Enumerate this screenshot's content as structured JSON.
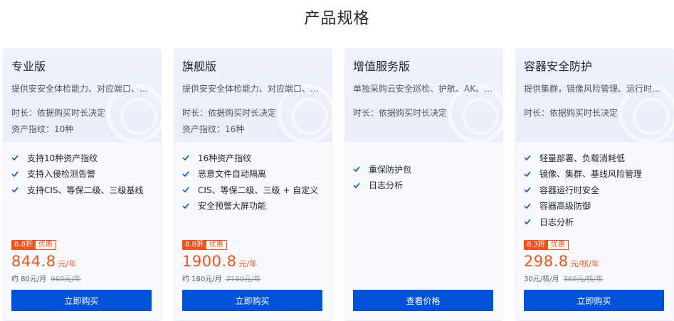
{
  "page_title": "产品规格",
  "icons": {
    "check": "check-icon",
    "watermark": "shield-watermark-icon"
  },
  "colors": {
    "accent": "#0052d9",
    "price": "#f0541e",
    "check": "#0052d9"
  },
  "cards": [
    {
      "title": "专业版",
      "desc": "提供安安全体检能力、对应端口、漏洞风险检测",
      "meta": [
        "时长：依据购买时长决定",
        "资产指纹：10种"
      ],
      "features": [
        "支持10种资产指纹",
        "支持入侵检测告警",
        "支持CIS、等保二级、三级基线"
      ],
      "badge": {
        "discount": "8.8折",
        "label": "优惠"
      },
      "price": "844.8",
      "unit": "元/年",
      "sub": "约 80元/月",
      "orig": "960元/年",
      "button": "立即购买"
    },
    {
      "title": "旗舰版",
      "desc": "提供安安全体检能力、对应端口、漏洞风险检测",
      "meta": [
        "时长：依据购买时长决定",
        "资产指纹：16种"
      ],
      "features": [
        "16种资产指纹",
        "恶意文件自动隔离",
        "CIS、等保二级、三级 + 自定义",
        "安全预警大屏功能"
      ],
      "badge": {
        "discount": "8.8折",
        "label": "优惠"
      },
      "price": "1900.8",
      "unit": "元/年",
      "sub": "约 180元/月",
      "orig": "2160元/年",
      "button": "立即购买"
    },
    {
      "title": "增值服务版",
      "desc": "单独采购云安全巡检、护航、AK、DNS监测服务",
      "meta": [
        "时长：依据购买时长决定"
      ],
      "features": [
        "重保防护包",
        "日志分析"
      ],
      "button": "查看价格"
    },
    {
      "title": "容器安全防护",
      "desc": "提供集群，镜像风险管理、运行时安全防护",
      "meta": [
        "时长：依据购买时长决定"
      ],
      "features": [
        "轻量部署、负载消耗低",
        "镜像、集群、基线风险管理",
        "容器运行时安全",
        "容器高级防御",
        "日志分析"
      ],
      "badge": {
        "discount": "8.3折",
        "label": "优惠"
      },
      "price": "298.8",
      "unit": "元/核/年",
      "sub": "30元/核/月",
      "orig": "360元/核/年",
      "button": "立即购买"
    }
  ]
}
